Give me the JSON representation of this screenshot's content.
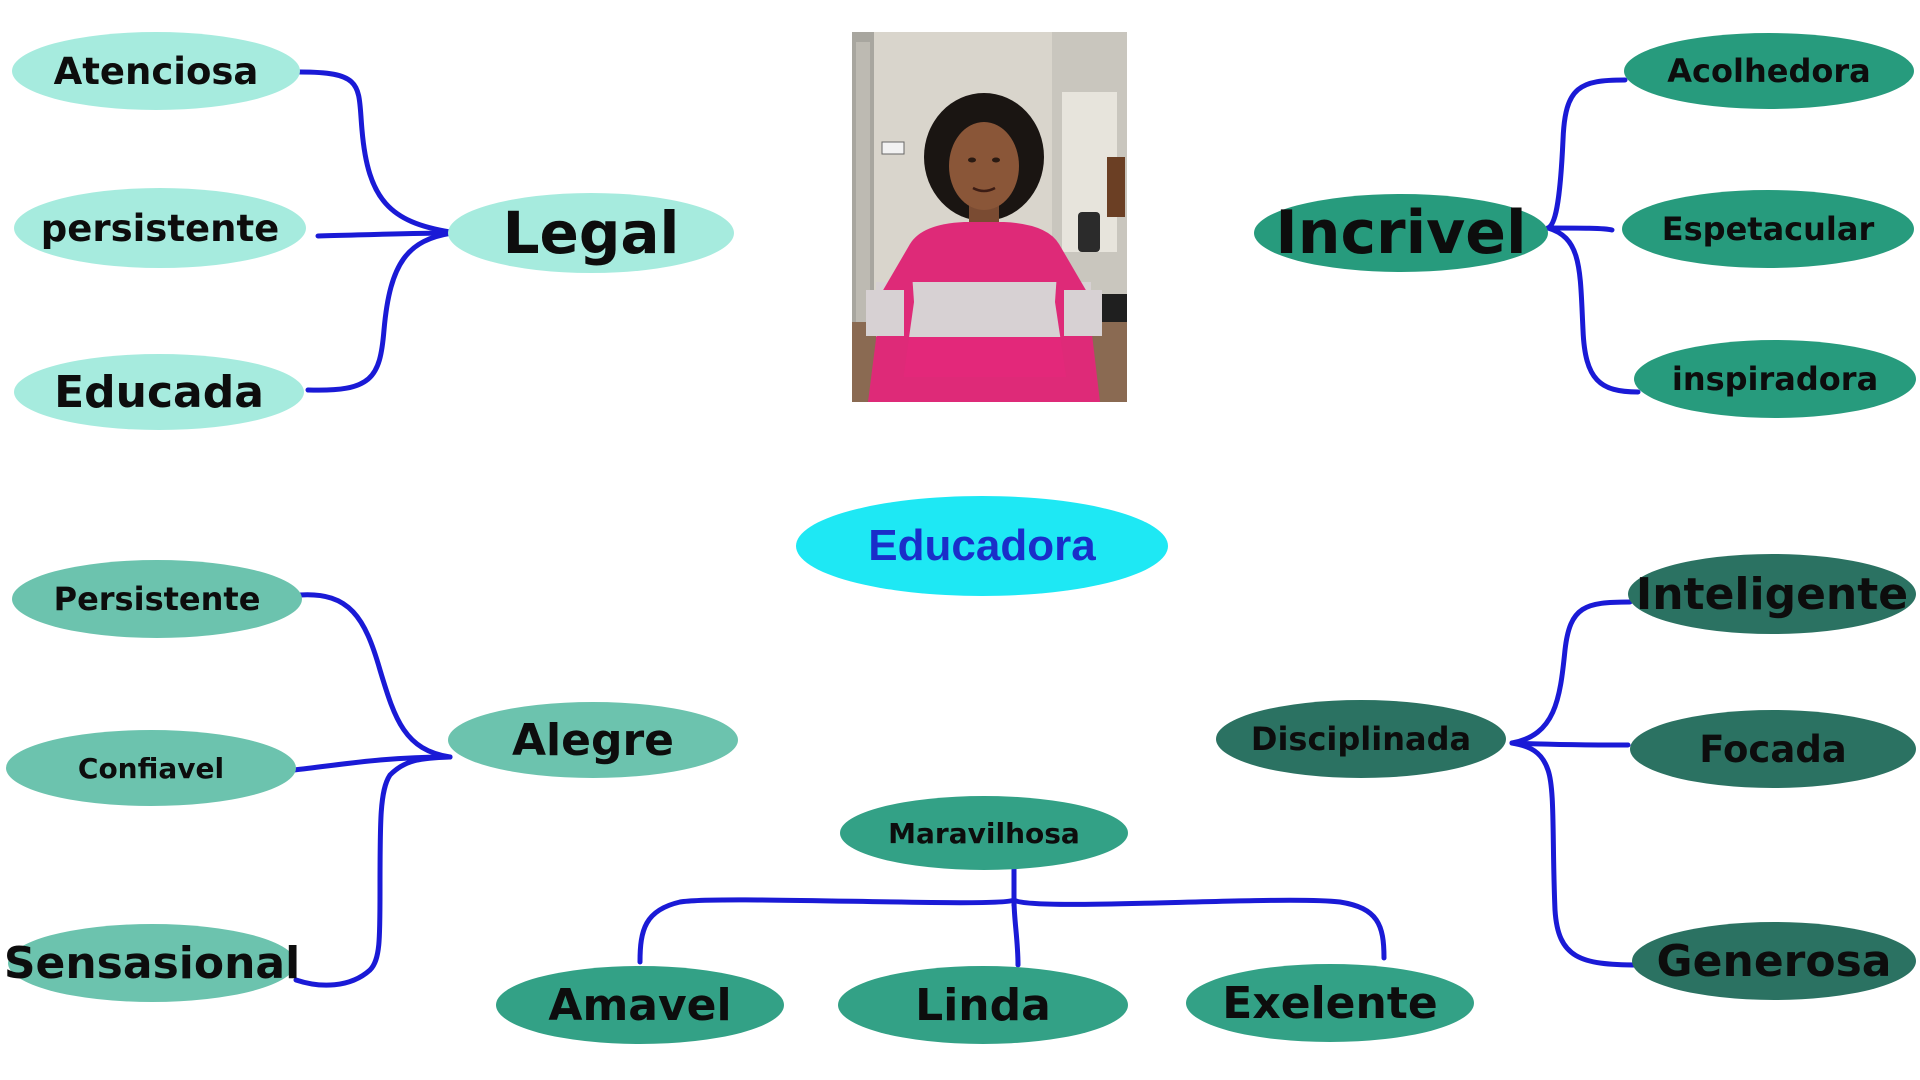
{
  "diagram": {
    "center": "Educadora",
    "groups": [
      {
        "label": "Legal",
        "children": [
          "Atenciosa",
          "persistente",
          "Educada"
        ]
      },
      {
        "label": "Incrivel",
        "children": [
          "Acolhedora",
          "Espetacular",
          "inspiradora"
        ]
      },
      {
        "label": "Alegre",
        "children": [
          "Persistente",
          "Confiavel",
          "Sensasional"
        ]
      },
      {
        "label": "Disciplinada",
        "children": [
          "Inteligente",
          "Focada",
          "Generosa"
        ]
      },
      {
        "label": "Maravilhosa",
        "children": [
          "Amavel",
          "Linda",
          "Exelente"
        ]
      }
    ]
  },
  "photo": {
    "icon": "woman-portrait-photo"
  },
  "colors": {
    "connector": "#1a1ad6",
    "center_fill": "#1ee8f4",
    "center_text": "#1a2ec9",
    "light_fill": "#a6ebde",
    "mid_fill": "#6cc3ae",
    "teal_fill": "#279b7d",
    "dark_fill": "#2b7262"
  }
}
